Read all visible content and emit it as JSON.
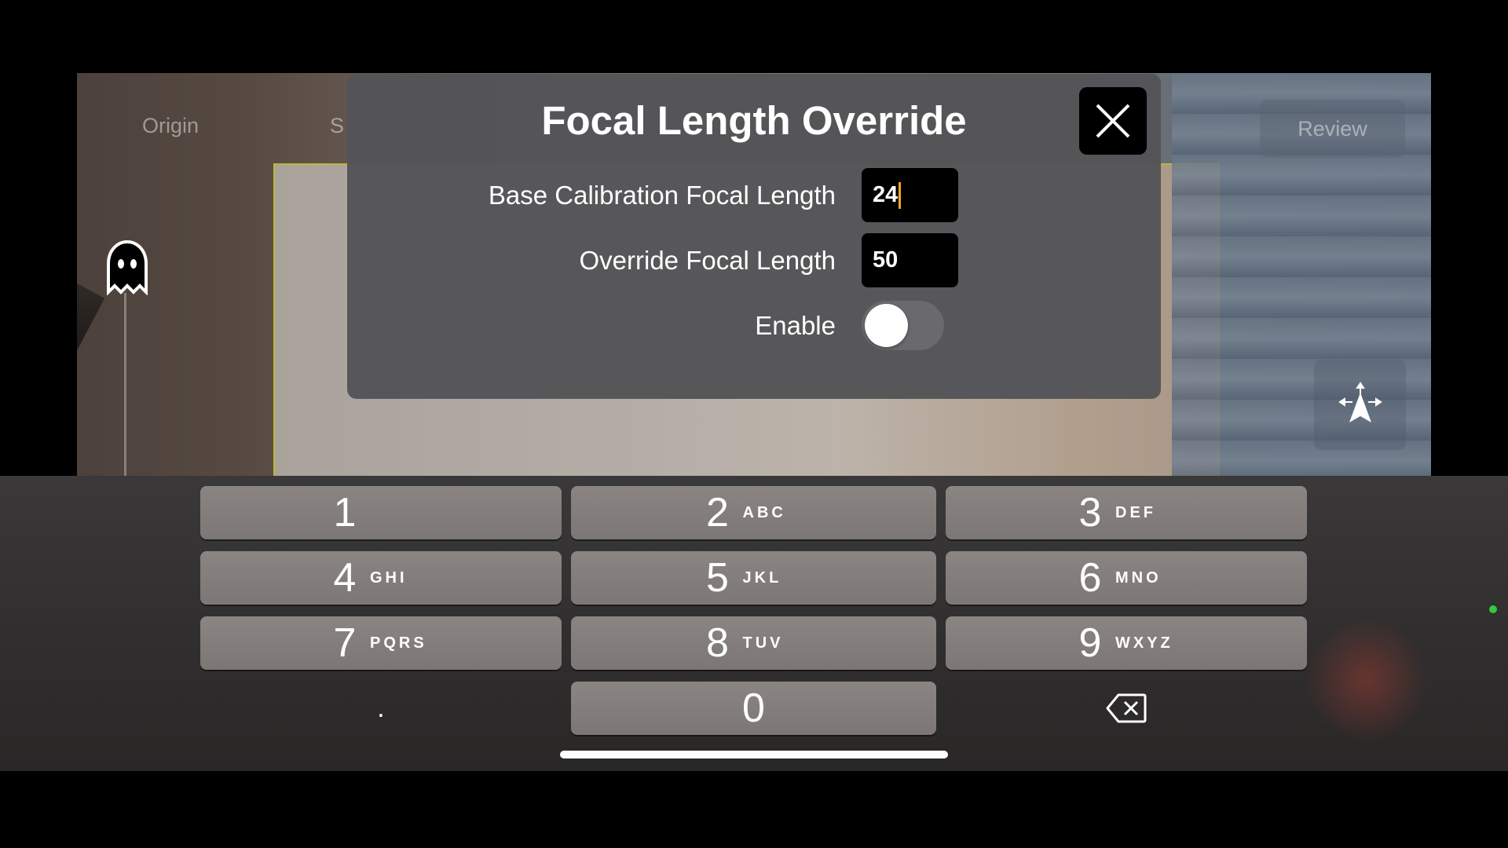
{
  "background": {
    "top_left_label": "Origin",
    "top_second_label": "S",
    "review_button": "Review",
    "ghost_icon": "ghost-icon",
    "move_icon": "move-arrows-icon"
  },
  "modal": {
    "title": "Focal Length Override",
    "close_icon": "close-icon",
    "fields": [
      {
        "label": "Base Calibration Focal Length",
        "value": "24"
      },
      {
        "label": "Override Focal Length",
        "value": "50"
      }
    ],
    "enable_label": "Enable",
    "enable_on": false,
    "caret_color": "#f5a623"
  },
  "keypad": {
    "rows": [
      [
        {
          "num": "1",
          "letters": ""
        },
        {
          "num": "2",
          "letters": "ABC"
        },
        {
          "num": "3",
          "letters": "DEF"
        }
      ],
      [
        {
          "num": "4",
          "letters": "GHI"
        },
        {
          "num": "5",
          "letters": "JKL"
        },
        {
          "num": "6",
          "letters": "MNO"
        }
      ],
      [
        {
          "num": "7",
          "letters": "PQRS"
        },
        {
          "num": "8",
          "letters": "TUV"
        },
        {
          "num": "9",
          "letters": "WXYZ"
        }
      ]
    ],
    "decimal": ".",
    "zero": "0",
    "backspace_icon": "backspace-icon"
  }
}
